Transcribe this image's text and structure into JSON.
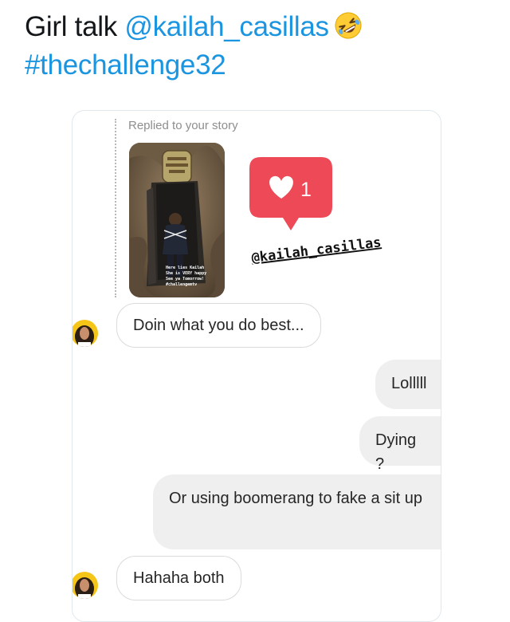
{
  "tweet": {
    "text_plain": "Girl talk",
    "mention": "@kailah_casillas",
    "hashtag": "#thechallenge32",
    "emoji": "rolling-on-the-floor-laughing-emoji"
  },
  "story_reply": {
    "replied_label": "Replied to your story",
    "thumbnail_caption": [
      "Here lies Kailah",
      "She is VERY happy",
      "See ya Tomorrow!",
      "#challengemtv"
    ],
    "reaction_count": "1",
    "mention_sticker": "@kailah_casillas"
  },
  "messages": [
    {
      "side": "in",
      "text": "Doin what you do best..."
    },
    {
      "side": "out",
      "text": "Lolllll"
    },
    {
      "side": "out",
      "text": "Dying ?"
    },
    {
      "side": "out",
      "text": "Or using boomerang to fake a sit up"
    },
    {
      "side": "in",
      "text": "Hahaha both"
    }
  ],
  "colors": {
    "link": "#1b95e0",
    "reaction_badge": "#ed4956",
    "incoming_border": "#dbdbdb",
    "outgoing_bubble": "#efefef"
  }
}
